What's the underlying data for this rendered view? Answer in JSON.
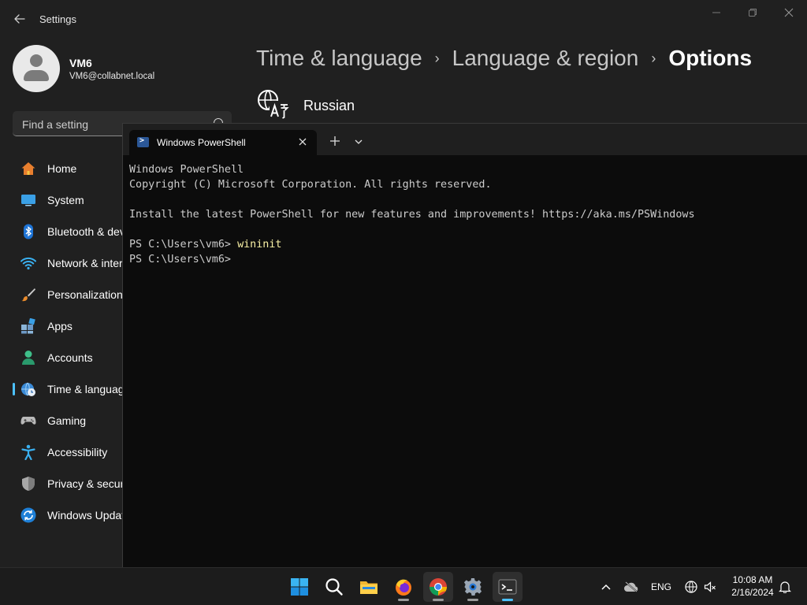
{
  "settings": {
    "app_title": "Settings",
    "user": {
      "name": "VM6",
      "email": "VM6@collabnet.local"
    },
    "search_placeholder": "Find a setting",
    "nav": [
      {
        "label": "Home",
        "icon": "home-icon"
      },
      {
        "label": "System",
        "icon": "system-icon"
      },
      {
        "label": "Bluetooth & devices",
        "icon": "bluetooth-icon"
      },
      {
        "label": "Network & internet",
        "icon": "wifi-icon"
      },
      {
        "label": "Personalization",
        "icon": "brush-icon"
      },
      {
        "label": "Apps",
        "icon": "apps-icon"
      },
      {
        "label": "Accounts",
        "icon": "accounts-icon"
      },
      {
        "label": "Time & language",
        "icon": "globe-clock-icon",
        "selected": true
      },
      {
        "label": "Gaming",
        "icon": "gamepad-icon"
      },
      {
        "label": "Accessibility",
        "icon": "accessibility-icon"
      },
      {
        "label": "Privacy & security",
        "icon": "shield-icon"
      },
      {
        "label": "Windows Update",
        "icon": "update-icon"
      }
    ],
    "breadcrumb": [
      "Time & language",
      "Language & region",
      "Options"
    ],
    "breadcrumb_separator": "›",
    "language": {
      "name": "Russian",
      "icon": "language-icon"
    }
  },
  "terminal": {
    "tab_title": "Windows PowerShell",
    "lines": [
      {
        "text": "Windows PowerShell"
      },
      {
        "text": "Copyright (C) Microsoft Corporation. All rights reserved."
      },
      {
        "text": ""
      },
      {
        "text": "Install the latest PowerShell for new features and improvements! https://aka.ms/PSWindows"
      },
      {
        "text": ""
      },
      {
        "prompt": "PS C:\\Users\\vm6> ",
        "command": "wininit"
      },
      {
        "prompt": "PS C:\\Users\\vm6>",
        "command": ""
      }
    ]
  },
  "taskbar": {
    "apps": [
      {
        "name": "start",
        "icon": "windows-logo-icon"
      },
      {
        "name": "search",
        "icon": "search-icon"
      },
      {
        "name": "file-explorer",
        "icon": "folder-icon"
      },
      {
        "name": "firefox",
        "icon": "firefox-icon"
      },
      {
        "name": "chrome",
        "icon": "chrome-icon"
      },
      {
        "name": "settings",
        "icon": "gear-icon"
      },
      {
        "name": "terminal",
        "icon": "terminal-icon"
      }
    ],
    "tray": {
      "language": "ENG",
      "time": "10:08 AM",
      "date": "2/16/2024"
    }
  },
  "colors": {
    "accent": "#4cc2ff",
    "settings_bg": "#202020",
    "terminal_bg": "#0c0c0c",
    "command": "#f9f1a5"
  }
}
